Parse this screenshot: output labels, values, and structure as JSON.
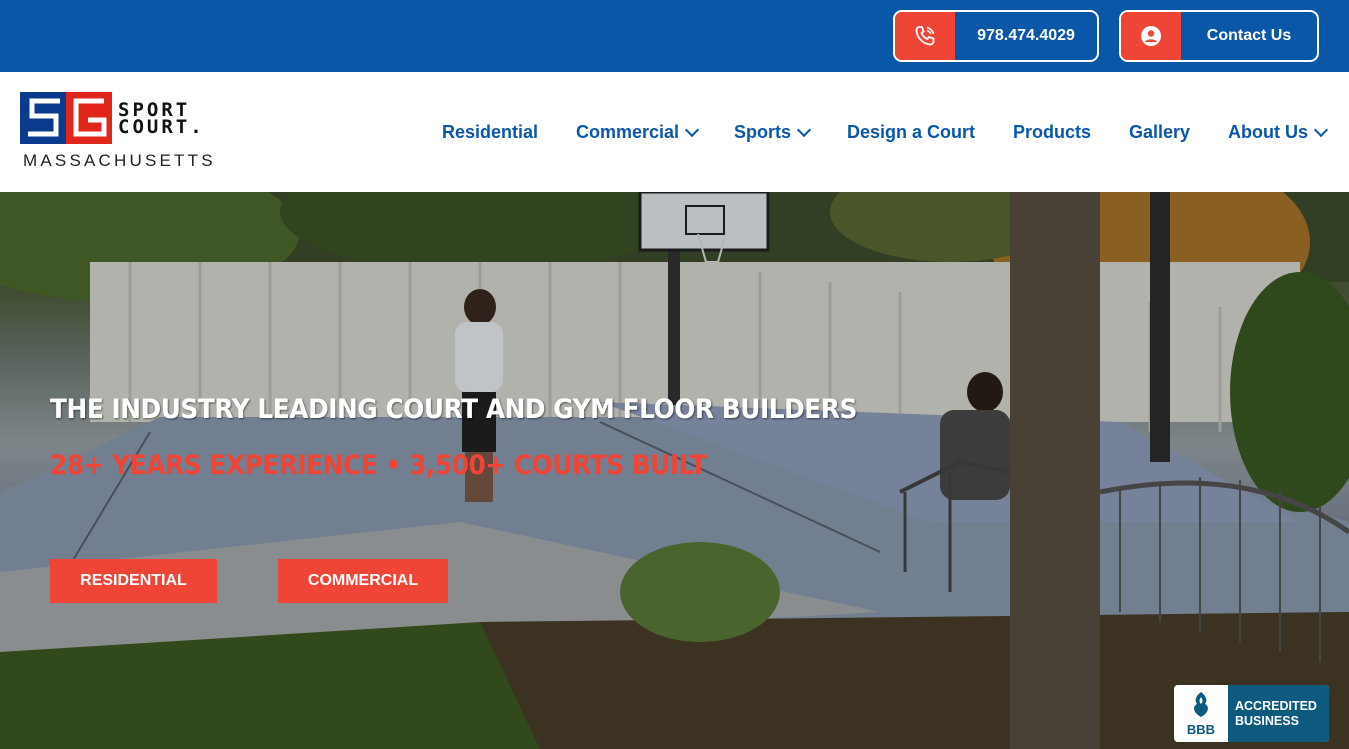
{
  "topbar": {
    "phone_label": "978.474.4029",
    "phone_icon": "phone-icon",
    "contact_label": "Contact Us",
    "contact_icon": "user-icon",
    "accent": "#ef4537",
    "brand": "#0a57a8"
  },
  "logo": {
    "word_line1": "SPORT",
    "word_line2": "COURT.",
    "state": "MASSACHUSETTS"
  },
  "nav": {
    "items": [
      {
        "label": "Residential",
        "dropdown": false
      },
      {
        "label": "Commercial",
        "dropdown": true
      },
      {
        "label": "Sports",
        "dropdown": true
      },
      {
        "label": "Design a Court",
        "dropdown": false
      },
      {
        "label": "Products",
        "dropdown": false
      },
      {
        "label": "Gallery",
        "dropdown": false
      },
      {
        "label": "About Us",
        "dropdown": true
      }
    ]
  },
  "hero": {
    "headline": "THE INDUSTRY LEADING COURT AND GYM FLOOR BUILDERS",
    "subline": "28+ YEARS EXPERIENCE • 3,500+ COURTS BUILT",
    "cta_residential": "RESIDENTIAL",
    "cta_commercial": "COMMERCIAL"
  },
  "bbb": {
    "line1": "ACCREDITED",
    "line2": "BUSINESS",
    "seal": "BBB"
  }
}
